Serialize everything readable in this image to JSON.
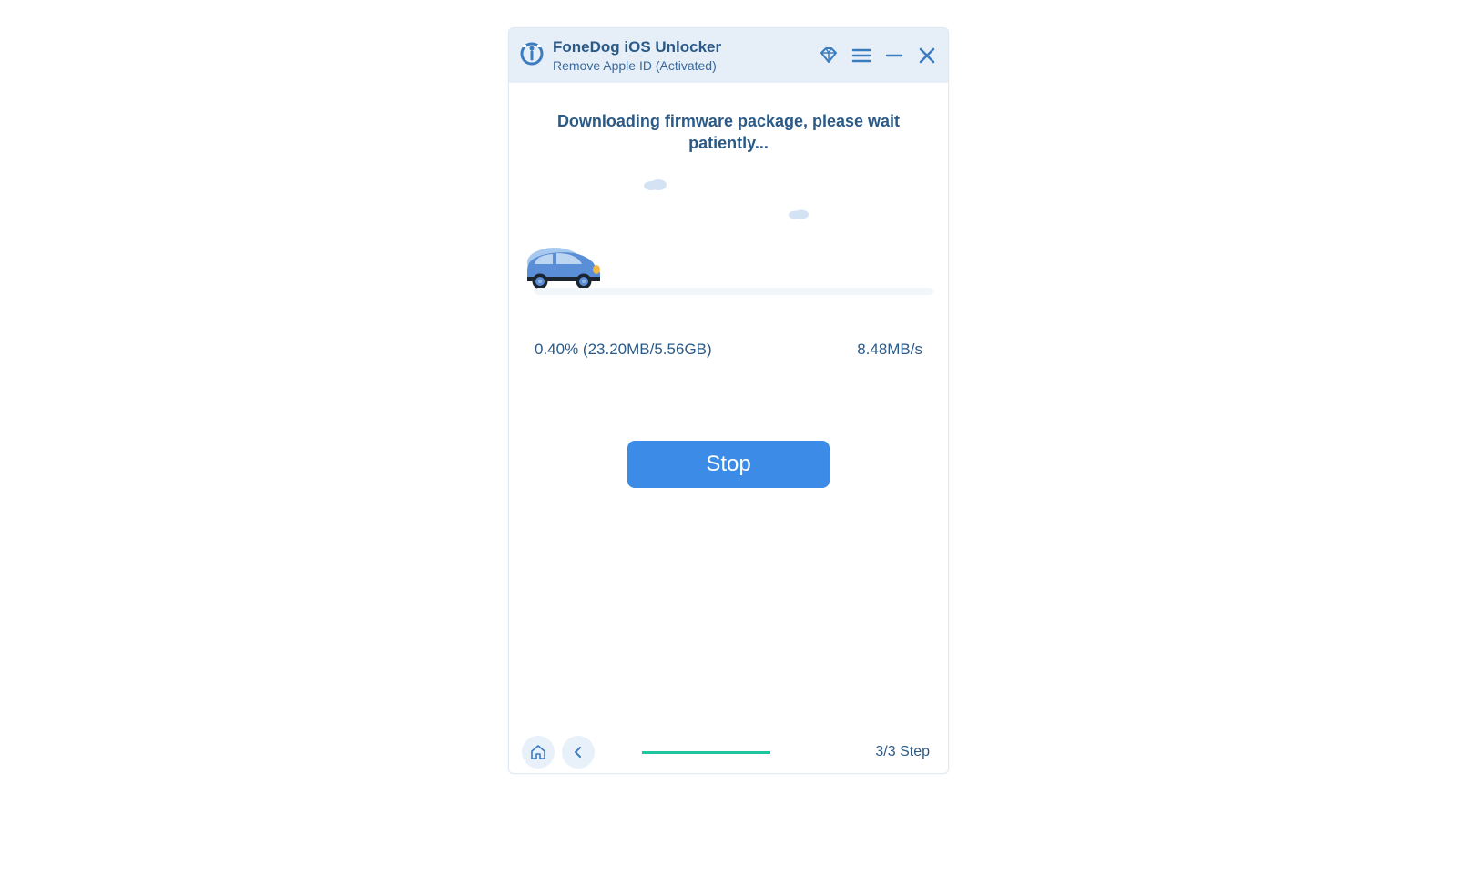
{
  "title": {
    "app_name": "FoneDog iOS Unlocker",
    "subtitle": "Remove Apple ID  (Activated)"
  },
  "main": {
    "heading": "Downloading firmware package, please wait patiently...",
    "progress_text": "0.40% (23.20MB/5.56GB)",
    "speed_text": "8.48MB/s",
    "stop_label": "Stop"
  },
  "footer": {
    "step_text": "3/3 Step"
  }
}
